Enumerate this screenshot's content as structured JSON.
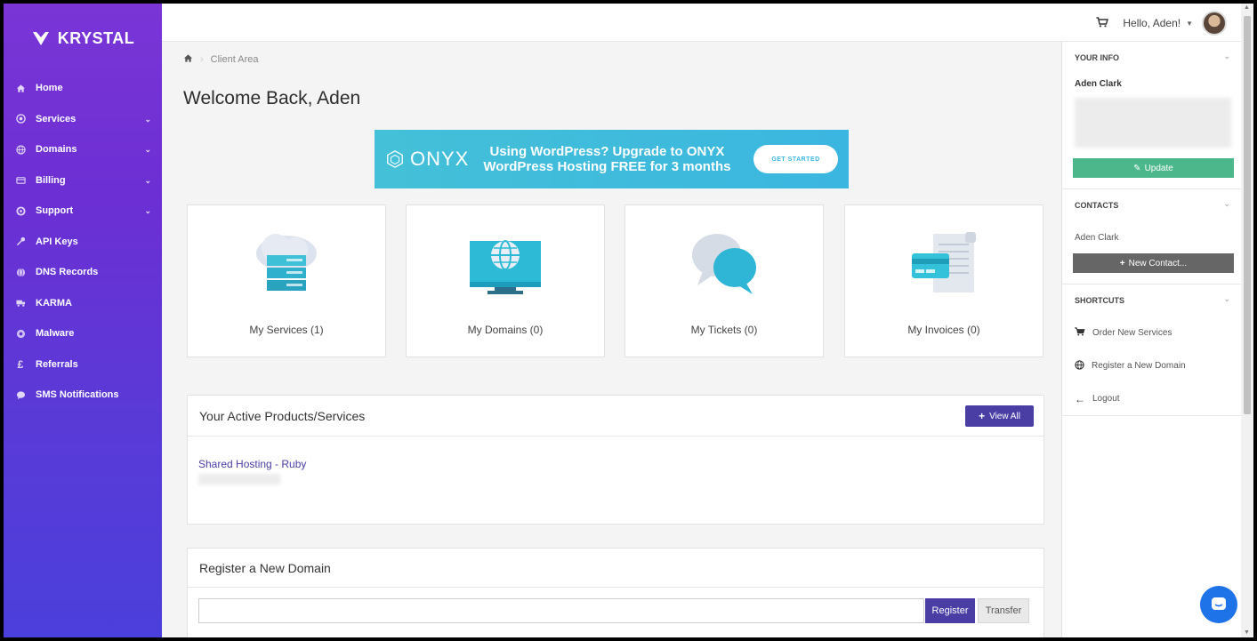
{
  "brand": {
    "name": "KRYSTAL"
  },
  "nav": [
    {
      "label": "Home",
      "icon": "home-icon",
      "caret": false
    },
    {
      "label": "Services",
      "icon": "cube-icon",
      "caret": true
    },
    {
      "label": "Domains",
      "icon": "globe-icon",
      "caret": true
    },
    {
      "label": "Billing",
      "icon": "credit-card-icon",
      "caret": true
    },
    {
      "label": "Support",
      "icon": "lifebuoy-icon",
      "caret": true
    },
    {
      "label": "API Keys",
      "icon": "key-icon",
      "caret": false
    },
    {
      "label": "DNS Records",
      "icon": "globe-icon",
      "caret": false
    },
    {
      "label": "KARMA",
      "icon": "truck-icon",
      "caret": false
    },
    {
      "label": "Malware",
      "icon": "bug-icon",
      "caret": false
    },
    {
      "label": "Referrals",
      "icon": "pound-icon",
      "caret": false
    },
    {
      "label": "SMS Notifications",
      "icon": "comment-icon",
      "caret": false
    }
  ],
  "topbar": {
    "greeting": "Hello, Aden!"
  },
  "breadcrumb": {
    "current": "Client Area"
  },
  "welcome": "Welcome Back, Aden",
  "banner": {
    "brand": "ONYX",
    "line1": "Using WordPress? Upgrade to ONYX",
    "line2": "WordPress Hosting FREE for 3 months",
    "cta": "GET STARTED"
  },
  "tiles": [
    {
      "label": "My Services (1)"
    },
    {
      "label": "My Domains (0)"
    },
    {
      "label": "My Tickets (0)"
    },
    {
      "label": "My Invoices (0)"
    }
  ],
  "products": {
    "title": "Your Active Products/Services",
    "view_all": "View All",
    "item": "Shared Hosting - Ruby"
  },
  "register": {
    "title": "Register a New Domain",
    "input_placeholder": "",
    "register_label": "Register",
    "transfer_label": "Transfer"
  },
  "right": {
    "your_info_title": "YOUR INFO",
    "name": "Aden Clark",
    "update_label": "Update",
    "contacts_title": "CONTACTS",
    "contact_name": "Aden Clark",
    "new_contact_label": "New Contact...",
    "shortcuts_title": "SHORTCUTS",
    "shortcuts": [
      {
        "label": "Order New Services",
        "icon": "cart-icon"
      },
      {
        "label": "Register a New Domain",
        "icon": "globe-icon"
      },
      {
        "label": "Logout",
        "icon": "arrow-left-icon"
      }
    ]
  },
  "colors": {
    "sidebar_top": "#7a35d6",
    "sidebar_bottom": "#4b3fdb",
    "primary": "#4a3ea5",
    "success": "#4bb78a",
    "banner": "#3bb6e0",
    "chat": "#1f73e8"
  }
}
